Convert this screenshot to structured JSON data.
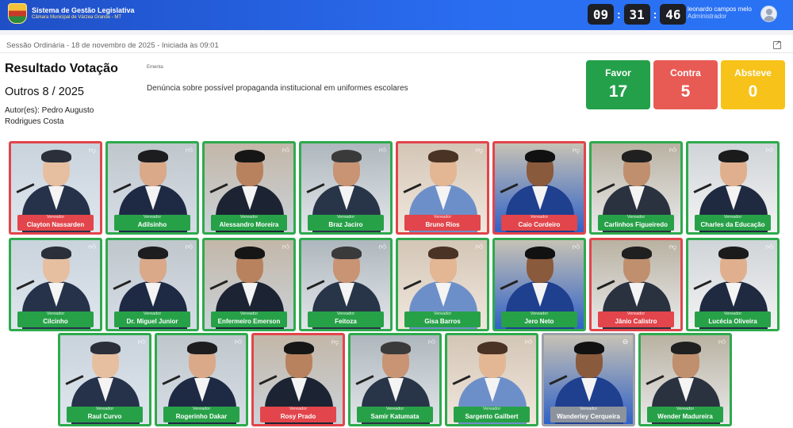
{
  "header": {
    "title": "Sistema de Gestão Legislativa",
    "subtitle": "Câmara Municipal de Várzea Grande - MT",
    "clock": {
      "hours": "09",
      "minutes": "31",
      "seconds": "46"
    },
    "user": {
      "name": "leonardo campos melo",
      "role": "Administrador"
    }
  },
  "session": {
    "info": "Sessão Ordinária - 18 de novembro de 2025 - Iniciada às 09:01"
  },
  "result": {
    "title": "Resultado Votação",
    "proposal": "Outros 8 / 2025",
    "author": "Autor(es): Pedro Augusto Rodrigues Costa",
    "ementa_label": "Ementa",
    "ementa": "Denúncia sobre possível propaganda institucional em uniformes escolares"
  },
  "tally": {
    "favor": {
      "label": "Favor",
      "value": "17",
      "color": "#24a04a"
    },
    "contra": {
      "label": "Contra",
      "value": "5",
      "color": "#e85b54"
    },
    "abstencao": {
      "label": "Absteve",
      "value": "0",
      "color": "#f7c31a"
    }
  },
  "vote_colors": {
    "favor": "#2eaa4d",
    "contra": "#e2454b",
    "none": "#9ba0a8"
  },
  "councilors": [
    {
      "role": "Vereador",
      "name": "Clayton Nassarden",
      "vote": "contra",
      "icon": "thumbs-down-icon"
    },
    {
      "role": "Vereador",
      "name": "Adilsinho",
      "vote": "favor",
      "icon": "thumbs-up-icon"
    },
    {
      "role": "Vereador",
      "name": "Alessandro Moreira",
      "vote": "favor",
      "icon": "thumbs-up-icon"
    },
    {
      "role": "Vereador",
      "name": "Braz Jaciro",
      "vote": "favor",
      "icon": "thumbs-up-icon"
    },
    {
      "role": "Vereador",
      "name": "Bruno Rios",
      "vote": "contra",
      "icon": "thumbs-down-icon"
    },
    {
      "role": "Vereador",
      "name": "Caio Cordeiro",
      "vote": "contra",
      "icon": "thumbs-down-icon"
    },
    {
      "role": "Vereador",
      "name": "Carlinhos Figueiredo",
      "vote": "favor",
      "icon": "thumbs-up-icon"
    },
    {
      "role": "Vereador",
      "name": "Charles da Educação",
      "vote": "favor",
      "icon": "thumbs-up-icon"
    },
    {
      "role": "Vereador",
      "name": "Cilcinho",
      "vote": "favor",
      "icon": "thumbs-up-icon"
    },
    {
      "role": "Vereador",
      "name": "Dr. Miguel Junior",
      "vote": "favor",
      "icon": "thumbs-up-icon"
    },
    {
      "role": "Vereador",
      "name": "Enfermeiro Emerson",
      "vote": "favor",
      "icon": "thumbs-up-icon"
    },
    {
      "role": "Vereador",
      "name": "Feitoza",
      "vote": "favor",
      "icon": "thumbs-up-icon"
    },
    {
      "role": "Vereador",
      "name": "Gisa Barros",
      "vote": "favor",
      "icon": "thumbs-up-icon"
    },
    {
      "role": "Vereador",
      "name": "Jero Neto",
      "vote": "favor",
      "icon": "thumbs-up-icon"
    },
    {
      "role": "Vereador",
      "name": "Jânio Calistro",
      "vote": "contra",
      "icon": "thumbs-down-icon"
    },
    {
      "role": "Vereador",
      "name": "Lucécia Oliveira",
      "vote": "favor",
      "icon": "thumbs-up-icon"
    },
    {
      "role": "Vereador",
      "name": "Raul Curvo",
      "vote": "favor",
      "icon": "thumbs-up-icon"
    },
    {
      "role": "Vereador",
      "name": "Rogerinho Dakar",
      "vote": "favor",
      "icon": "thumbs-up-icon"
    },
    {
      "role": "Vereador",
      "name": "Rosy Prado",
      "vote": "contra",
      "icon": "thumbs-down-icon"
    },
    {
      "role": "Vereador",
      "name": "Samir Katumata",
      "vote": "favor",
      "icon": "thumbs-up-icon"
    },
    {
      "role": "Vereador",
      "name": "Sargento Gailbert",
      "vote": "favor",
      "icon": "thumbs-up-icon"
    },
    {
      "role": "Vereador",
      "name": "Wanderley Cerqueira",
      "vote": "none",
      "icon": "minus-circle-icon"
    },
    {
      "role": "Vereador",
      "name": "Wender Madureira",
      "vote": "favor",
      "icon": "thumbs-up-icon"
    }
  ]
}
